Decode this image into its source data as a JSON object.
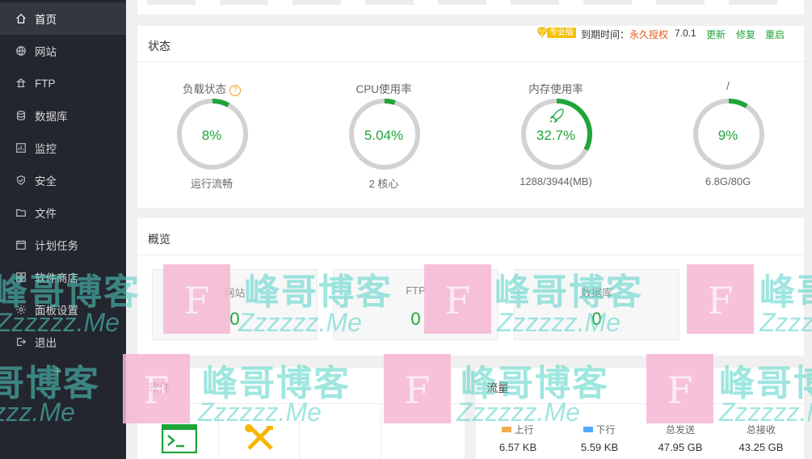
{
  "sidebar": {
    "items": [
      {
        "label": "首页",
        "icon": "home-icon",
        "active": true
      },
      {
        "label": "网站",
        "icon": "globe-icon"
      },
      {
        "label": "FTP",
        "icon": "ftp-icon"
      },
      {
        "label": "数据库",
        "icon": "database-icon"
      },
      {
        "label": "监控",
        "icon": "monitor-icon"
      },
      {
        "label": "安全",
        "icon": "shield-icon"
      },
      {
        "label": "文件",
        "icon": "folder-icon"
      },
      {
        "label": "计划任务",
        "icon": "calendar-icon"
      },
      {
        "label": "软件商店",
        "icon": "grid-icon"
      },
      {
        "label": "面板设置",
        "icon": "gear-icon"
      },
      {
        "label": "退出",
        "icon": "logout-icon"
      }
    ],
    "add": "+"
  },
  "status": {
    "title": "状态",
    "badge": "专业版",
    "expire_label": "到期时间：",
    "expire_value": "永久授权",
    "version": "7.0.1",
    "update": "更新",
    "repair": "修复",
    "restart": "重启",
    "gauges": [
      {
        "title": "负载状态",
        "value": "8%",
        "percent": 8,
        "sub": "运行流畅",
        "help": "?"
      },
      {
        "title": "CPU使用率",
        "value": "5.04%",
        "percent": 5.04,
        "sub": "2 核心"
      },
      {
        "title": "内存使用率",
        "value": "32.7%",
        "percent": 32.7,
        "sub": "1288/3944(MB)"
      },
      {
        "title": "/",
        "value": "9%",
        "percent": 9,
        "sub": "6.8G/80G"
      }
    ]
  },
  "overview": {
    "title": "概览",
    "cards": [
      {
        "label": "网站",
        "value": "0"
      },
      {
        "label": "FTP",
        "value": "0"
      },
      {
        "label": "数据库",
        "value": "0"
      }
    ]
  },
  "software": {
    "title": "软件"
  },
  "traffic": {
    "title": "流量",
    "cols": [
      {
        "label": "上行",
        "value": "6.57 KB",
        "color": "#f0ad4e"
      },
      {
        "label": "下行",
        "value": "5.59 KB",
        "color": "#52a9ff"
      },
      {
        "label": "总发送",
        "value": "47.95 GB"
      },
      {
        "label": "总接收",
        "value": "43.25 GB"
      }
    ]
  },
  "watermark": {
    "cn": "峰哥博客",
    "en": "Zzzzzz.Me",
    "letter": "F"
  },
  "colors": {
    "accent": "#20a53a",
    "sidebar": "#23262e",
    "warning": "#e45b1a"
  }
}
